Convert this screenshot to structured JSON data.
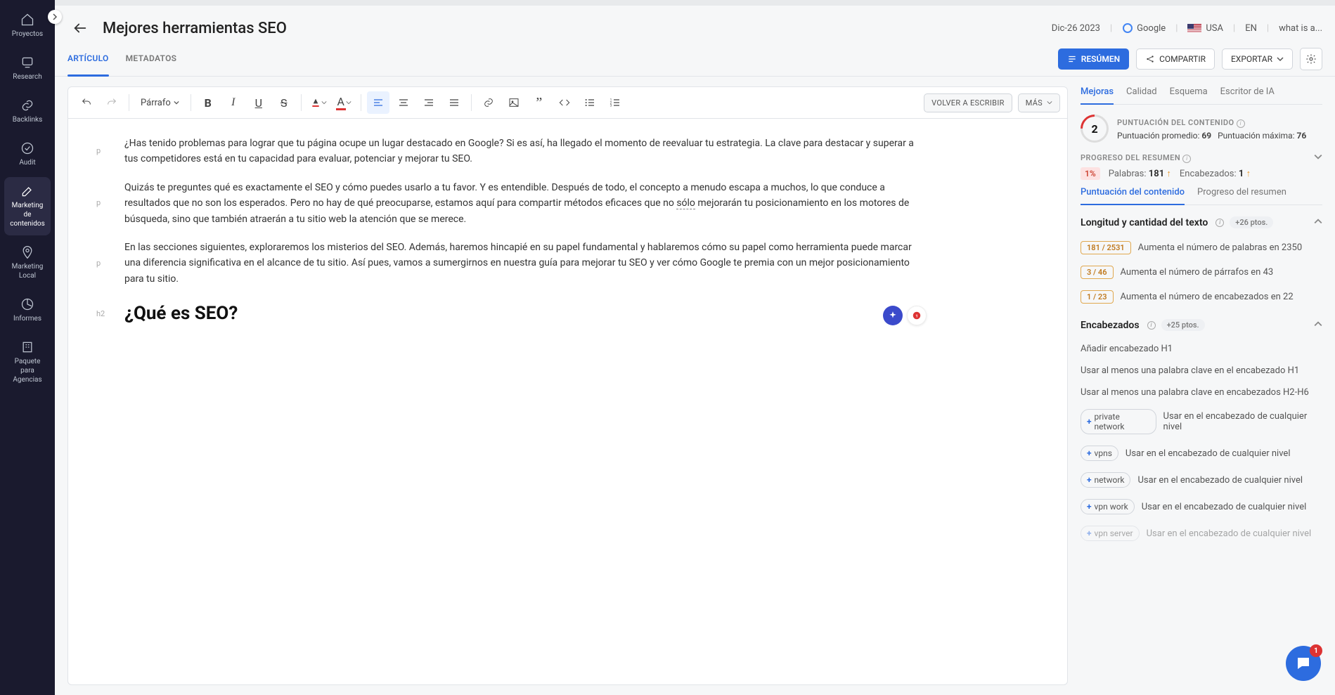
{
  "sidebar": {
    "items": [
      {
        "label": "Proyectos"
      },
      {
        "label": "Research"
      },
      {
        "label": "Backlinks"
      },
      {
        "label": "Audit"
      },
      {
        "label": "Marketing de contenidos"
      },
      {
        "label": "Marketing Local"
      },
      {
        "label": "Informes"
      },
      {
        "label": "Paquete para Agencias"
      }
    ]
  },
  "header": {
    "title": "Mejores herramientas SEO",
    "date": "Dic-26 2023",
    "google": "Google",
    "country": "USA",
    "lang": "EN",
    "keyword": "what is a..."
  },
  "tabs": {
    "article": "ARTÍCULO",
    "metadata": "METADATOS"
  },
  "actions": {
    "resumen": "RESÚMEN",
    "compartir": "COMPARTIR",
    "exportar": "EXPORTAR"
  },
  "toolbar": {
    "paragraph": "Párrafo",
    "rewrite": "VOLVER A ESCRIBIR",
    "more": "MÁS"
  },
  "editor": {
    "p1": "¿Has tenido problemas para lograr que tu página ocupe un lugar destacado en Google? Si es así, ha llegado el momento de reevaluar tu estrategia. La clave para destacar y superar a tus competidores está en tu capacidad para evaluar, potenciar y mejorar tu SEO.",
    "p2a": "Quizás te preguntes qué es exactamente el SEO y cómo puedes usarlo a tu favor. Y es entendible. Después de todo, el concepto a menudo escapa a muchos, lo que conduce a resultados que no son los esperados. Pero no hay de qué preocuparse, estamos aquí para compartir métodos eficaces que no ",
    "p2u": "sólo",
    "p2b": " mejorarán tu posicionamiento en los motores de búsqueda, sino que también atraerán a tu sitio web la atención que se merece.",
    "p3": "En las secciones siguientes, exploraremos los misterios del SEO. Además, haremos hincapié en su papel fundamental y hablaremos cómo su papel como herramienta puede marcar una diferencia significativa en el alcance de tu sitio. Así pues, vamos a sumergirnos en nuestra guía para mejorar tu SEO y ver cómo Google te premia con un mejor posicionamiento para tu sitio.",
    "h2": "¿Qué es SEO?",
    "tag_p": "p",
    "tag_h2": "h2"
  },
  "panel": {
    "tabs": [
      "Mejoras",
      "Calidad",
      "Esquema",
      "Escritor de IA"
    ],
    "score": {
      "label": "PUNTUACIÓN DEL CONTENIDO",
      "value": "2",
      "avg_lbl": "Puntuación promedio:",
      "avg": "69",
      "max_lbl": "Puntuación máxima:",
      "max": "76"
    },
    "progress": {
      "label": "PROGRESO DEL RESUMEN",
      "percent": "1%",
      "words_lbl": "Palabras:",
      "words": "181",
      "headers_lbl": "Encabezados:",
      "headers": "1"
    },
    "subtabs": [
      "Puntuación del contenido",
      "Progreso del resumen"
    ],
    "section1": {
      "title": "Longitud y cantidad del texto",
      "pts": "+26 ptos.",
      "recs": [
        {
          "chip": "181 / 2531",
          "text": "Aumenta el número de palabras en 2350"
        },
        {
          "chip": "3 / 46",
          "text": "Aumenta el número de párrafos en 43"
        },
        {
          "chip": "1 / 23",
          "text": "Aumenta el número de encabezados en 22"
        }
      ]
    },
    "section2": {
      "title": "Encabezados",
      "pts": "+25 ptos.",
      "simple": [
        "Añadir encabezado H1",
        "Usar al menos una palabra clave en el encabezado H1",
        "Usar al menos una palabra clave en encabezados H2-H6"
      ],
      "kw": [
        {
          "chip": "private network",
          "text": "Usar en el encabezado de cualquier nivel"
        },
        {
          "chip": "vpns",
          "text": "Usar en el encabezado de cualquier nivel"
        },
        {
          "chip": "network",
          "text": "Usar en el encabezado de cualquier nivel"
        },
        {
          "chip": "vpn work",
          "text": "Usar en el encabezado de cualquier nivel"
        },
        {
          "chip": "vpn server",
          "text": "Usar en el encabezado de cualquier nivel"
        }
      ]
    }
  },
  "chat": {
    "badge": "1"
  }
}
